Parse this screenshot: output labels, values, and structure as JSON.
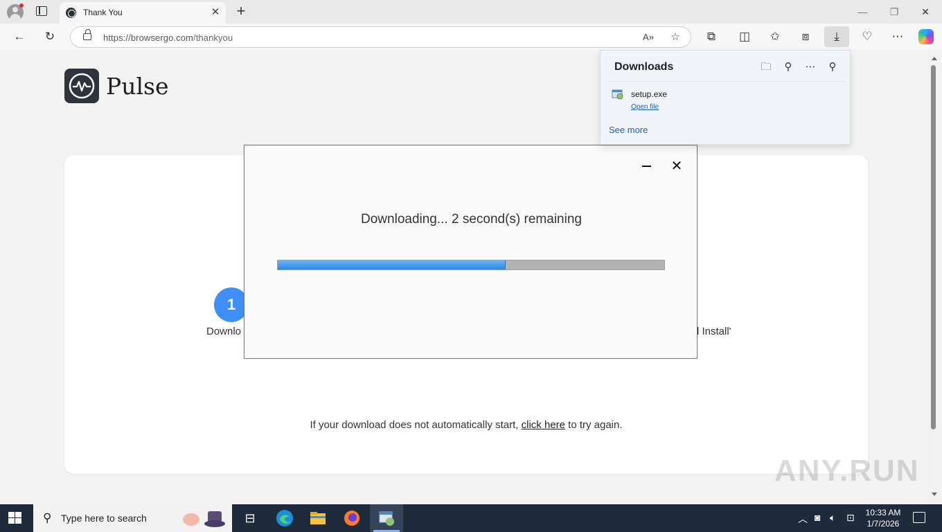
{
  "browser": {
    "tab_title": "Thank You",
    "tab_close": "✕",
    "new_tab": "+",
    "url_host": "https://browsergo.com",
    "url_path": "/thankyou",
    "window_minimize": "—",
    "window_restore": "❐",
    "window_close": "✕"
  },
  "page": {
    "brand": "Pulse",
    "step1_number": "1",
    "step1_label": "Downlo",
    "step3_label": "l Install'",
    "retry_prefix": "If your download does not automatically start, ",
    "retry_link": "click here",
    "retry_suffix": " to try again."
  },
  "dialog": {
    "message": "Downloading... 2 second(s) remaining",
    "progress": 0.59,
    "close": "✕"
  },
  "downloads": {
    "title": "Downloads",
    "file_name": "setup.exe",
    "open_file": "Open file",
    "see_more": "See more"
  },
  "taskbar": {
    "search_placeholder": "Type here to search",
    "time": "10:33 AM",
    "date": "1/7/2026"
  },
  "watermark": "ANY.RUN",
  "icons": {
    "accent": "#3e8ff6",
    "progress_fill": "#2c86e6"
  }
}
